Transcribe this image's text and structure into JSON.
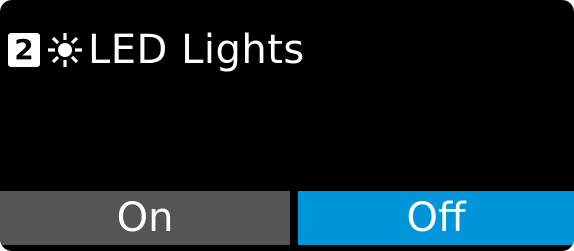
{
  "header": {
    "number": "2",
    "icon": "light-icon",
    "title": "LED Lights"
  },
  "buttons": {
    "on_label": "On",
    "off_label": "Off"
  },
  "colors": {
    "background": "#000000",
    "on_button": "#555555",
    "off_button": "#0095d9",
    "text": "#ffffff"
  }
}
